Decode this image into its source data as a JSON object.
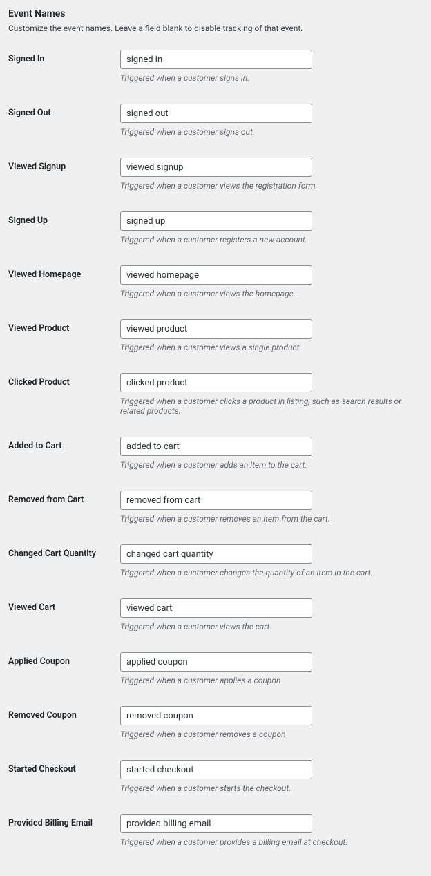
{
  "section": {
    "title": "Event Names",
    "description": "Customize the event names. Leave a field blank to disable tracking of that event."
  },
  "fields": [
    {
      "label": "Signed In",
      "value": "signed in",
      "description": "Triggered when a customer signs in."
    },
    {
      "label": "Signed Out",
      "value": "signed out",
      "description": "Triggered when a customer signs out."
    },
    {
      "label": "Viewed Signup",
      "value": "viewed signup",
      "description": "Triggered when a customer views the registration form."
    },
    {
      "label": "Signed Up",
      "value": "signed up",
      "description": "Triggered when a customer registers a new account."
    },
    {
      "label": "Viewed Homepage",
      "value": "viewed homepage",
      "description": "Triggered when a customer views the homepage."
    },
    {
      "label": "Viewed Product",
      "value": "viewed product",
      "description": "Triggered when a customer views a single product"
    },
    {
      "label": "Clicked Product",
      "value": "clicked product",
      "description": "Triggered when a customer clicks a product in listing, such as search results or related products."
    },
    {
      "label": "Added to Cart",
      "value": "added to cart",
      "description": "Triggered when a customer adds an item to the cart."
    },
    {
      "label": "Removed from Cart",
      "value": "removed from cart",
      "description": "Triggered when a customer removes an item from the cart."
    },
    {
      "label": "Changed Cart Quantity",
      "value": "changed cart quantity",
      "description": "Triggered when a customer changes the quantity of an item in the cart."
    },
    {
      "label": "Viewed Cart",
      "value": "viewed cart",
      "description": "Triggered when a customer views the cart."
    },
    {
      "label": "Applied Coupon",
      "value": "applied coupon",
      "description": "Triggered when a customer applies a coupon"
    },
    {
      "label": "Removed Coupon",
      "value": "removed coupon",
      "description": "Triggered when a customer removes a coupon"
    },
    {
      "label": "Started Checkout",
      "value": "started checkout",
      "description": "Triggered when a customer starts the checkout."
    },
    {
      "label": "Provided Billing Email",
      "value": "provided billing email",
      "description": "Triggered when a customer provides a billing email at checkout."
    }
  ]
}
